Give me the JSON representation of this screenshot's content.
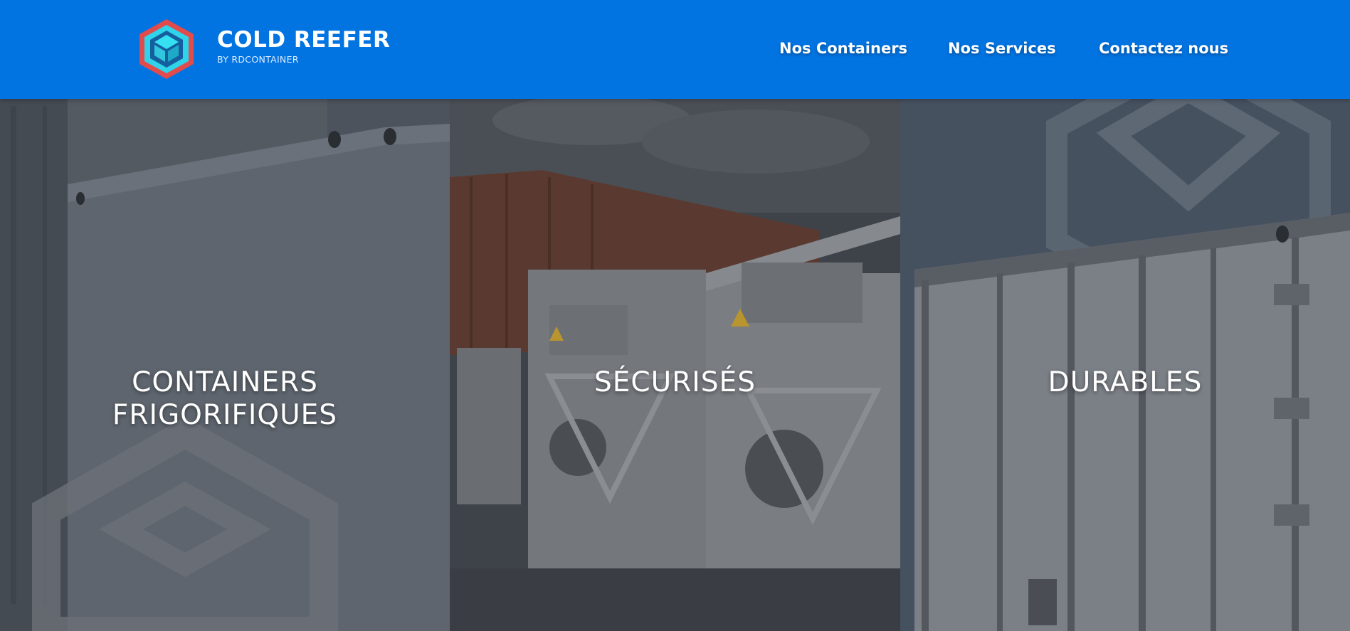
{
  "header": {
    "brand_title": "COLD REEFER",
    "brand_subtitle": "BY RDCONTAINER",
    "logo_icon": "hexagon-cube-logo-icon",
    "background_color": "#0274e2"
  },
  "nav": {
    "items": [
      {
        "label": "Nos Containers"
      },
      {
        "label": "Nos Services"
      },
      {
        "label": "Contactez nous"
      }
    ]
  },
  "panels": [
    {
      "title_line1": "CONTAINERS",
      "title_line2": "FRIGORIFIQUES",
      "overlay_color": "#4a515b"
    },
    {
      "title": "SÉCURISÉS",
      "overlay_color": "#3d434b"
    },
    {
      "title": "DURABLES",
      "overlay_color": "#465160"
    }
  ]
}
